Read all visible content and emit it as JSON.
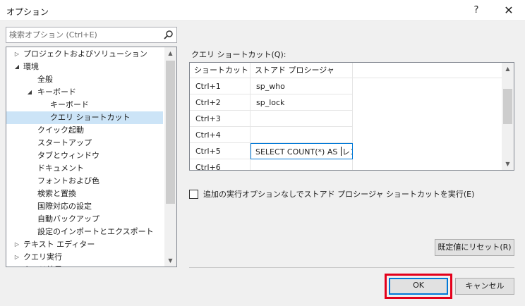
{
  "window": {
    "title": "オプション",
    "help_label": "?",
    "close_label": "✕"
  },
  "search": {
    "placeholder": "検索オプション (Ctrl+E)"
  },
  "tree": {
    "items": [
      {
        "label": "プロジェクトおよびソリューション",
        "arrow": "▷",
        "level": 0
      },
      {
        "label": "環境",
        "arrow": "◢",
        "level": 0
      },
      {
        "label": "全般",
        "arrow": "",
        "level": 1
      },
      {
        "label": "キーボード",
        "arrow": "◢",
        "level": 1
      },
      {
        "label": "キーボード",
        "arrow": "",
        "level": 2
      },
      {
        "label": "クエリ ショートカット",
        "arrow": "",
        "level": 2,
        "selected": true
      },
      {
        "label": "クイック起動",
        "arrow": "",
        "level": 1
      },
      {
        "label": "スタートアップ",
        "arrow": "",
        "level": 1
      },
      {
        "label": "タブとウィンドウ",
        "arrow": "",
        "level": 1
      },
      {
        "label": "ドキュメント",
        "arrow": "",
        "level": 1
      },
      {
        "label": "フォントおよび色",
        "arrow": "",
        "level": 1
      },
      {
        "label": "検索と置換",
        "arrow": "",
        "level": 1
      },
      {
        "label": "国際対応の設定",
        "arrow": "",
        "level": 1
      },
      {
        "label": "自動バックアップ",
        "arrow": "",
        "level": 1
      },
      {
        "label": "設定のインポートとエクスポート",
        "arrow": "",
        "level": 1
      },
      {
        "label": "テキスト エディター",
        "arrow": "▷",
        "level": 0
      },
      {
        "label": "クエリ実行",
        "arrow": "▷",
        "level": 0
      },
      {
        "label": "クエリ結果",
        "arrow": "▷",
        "level": 0
      }
    ]
  },
  "shortcuts": {
    "label": "クエリ ショートカット(Q):",
    "columns": [
      "ショートカット",
      "ストアド プロシージャ"
    ],
    "rows": [
      {
        "key": "Ctrl+1",
        "value": "sp_who"
      },
      {
        "key": "Ctrl+2",
        "value": "sp_lock"
      },
      {
        "key": "Ctrl+3",
        "value": ""
      },
      {
        "key": "Ctrl+4",
        "value": ""
      },
      {
        "key": "Ctrl+5",
        "value": "SELECT COUNT(*) AS レコー"
      },
      {
        "key": "Ctrl+6",
        "value": ""
      }
    ],
    "editing_value_before_caret": "SELECT COUNT(*) AS ",
    "editing_value_after_caret": "レコー"
  },
  "options": {
    "run_without_options_label": "追加の実行オプションなしでストアド プロシージャ ショートカットを実行(E)",
    "run_without_options_checked": false
  },
  "buttons": {
    "reset_label": "既定値にリセット(R)",
    "ok_label": "OK",
    "cancel_label": "キャンセル"
  },
  "colors": {
    "highlight_border": "#e4001b",
    "selection": "#cce4f7",
    "focus": "#0078d7"
  }
}
